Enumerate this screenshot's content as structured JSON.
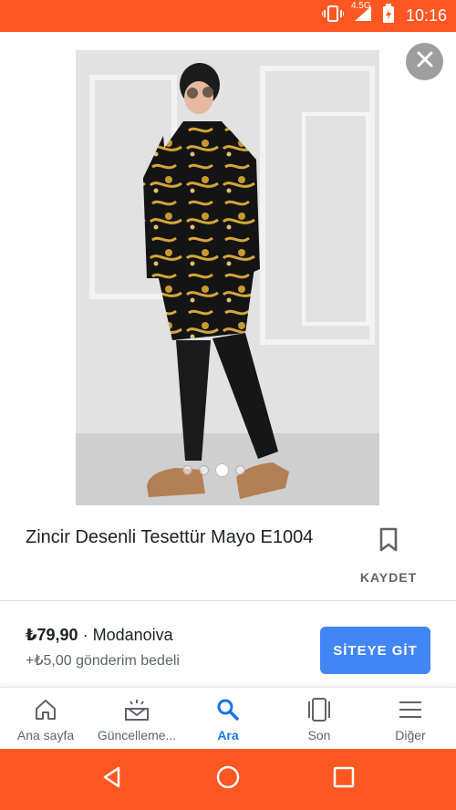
{
  "status_bar": {
    "time": "10:16",
    "network": "4.5G",
    "icons": [
      "vibrate-icon",
      "signal-icon",
      "battery-icon"
    ],
    "color": "#ff5722"
  },
  "product": {
    "title": "Zincir Desenli Tesettür Mayo E1004",
    "save_label": "KAYDET",
    "price": "₺79,90",
    "seller_separator": " · ",
    "seller": "Modanoiva",
    "shipping": "+₺5,00 gönderim bedeli",
    "visit_label": "SİTEYE GİT",
    "image_count": 4,
    "active_image": 2
  },
  "bottom_nav": {
    "items": [
      {
        "label": "Ana sayfa",
        "icon": "home-icon"
      },
      {
        "label": "Güncelleme...",
        "icon": "updates-icon"
      },
      {
        "label": "Ara",
        "icon": "search-icon",
        "active": true
      },
      {
        "label": "Son",
        "icon": "recent-icon"
      },
      {
        "label": "Diğer",
        "icon": "menu-icon"
      }
    ]
  },
  "colors": {
    "accent": "#1a73e8",
    "button": "#4285f4",
    "system_bar": "#ff5722"
  }
}
